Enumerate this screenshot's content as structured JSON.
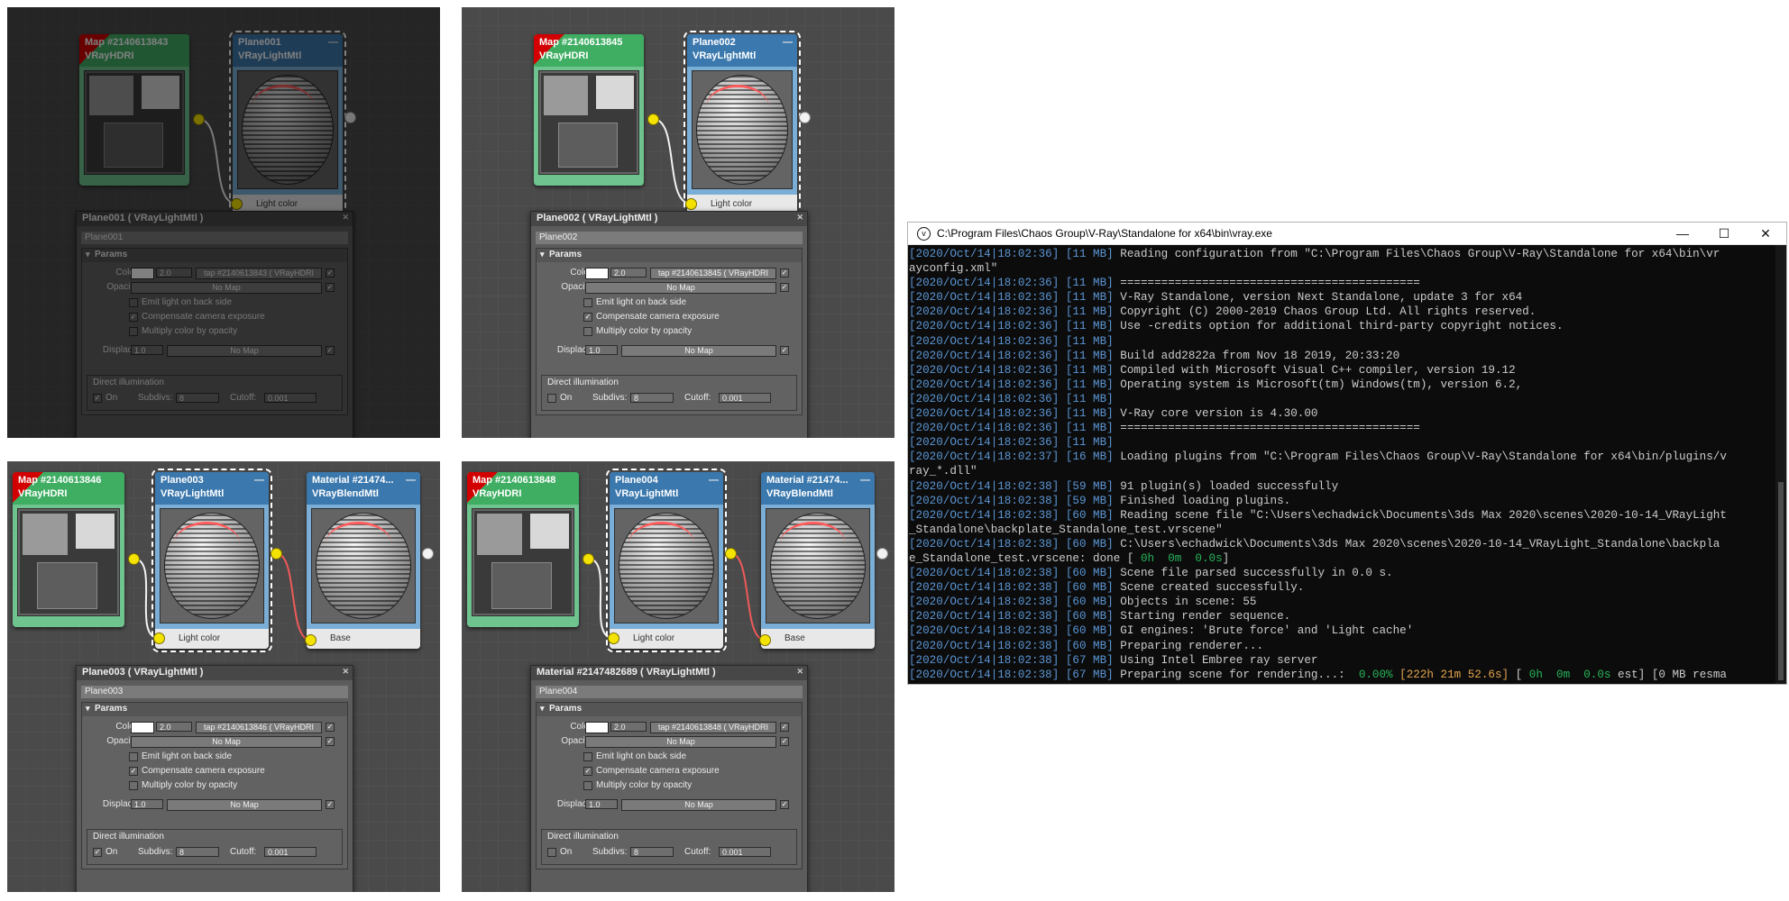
{
  "panels": [
    {
      "id": "p1",
      "dim": true,
      "hdri_node": {
        "title": "Map #2140613843",
        "type": "VRayHDRI"
      },
      "light_node": {
        "title": "Plane001",
        "type": "VRayLightMtl",
        "slot": "Light color"
      },
      "rollout": {
        "title": "Plane001  ( VRayLightMtl )",
        "name": "Plane001",
        "group": "Params",
        "color_label": "Color:",
        "color_mult": "2.0",
        "color_map": "tap #2140613843  ( VRayHDRI",
        "opacity_label": "Opacity:",
        "opacity_map": "No Map",
        "chk_back": "Emit light on back side",
        "chk_comp": "Compensate camera exposure",
        "chk_mult": "Multiply color by opacity",
        "displace_label": "Displace:",
        "displace_val": "1.0",
        "displace_map": "No Map",
        "di_title": "Direct illumination",
        "on_label": "On",
        "on_checked": true,
        "subdivs_label": "Subdivs:",
        "subdivs_val": "8",
        "cutoff_label": "Cutoff:",
        "cutoff_val": "0.001"
      }
    },
    {
      "id": "p2",
      "dim": false,
      "hdri_node": {
        "title": "Map #2140613845",
        "type": "VRayHDRI"
      },
      "light_node": {
        "title": "Plane002",
        "type": "VRayLightMtl",
        "slot": "Light color"
      },
      "rollout": {
        "title": "Plane002  ( VRayLightMtl )",
        "name": "Plane002",
        "group": "Params",
        "color_label": "Color:",
        "color_mult": "2.0",
        "color_map": "tap #2140613845  ( VRayHDRI",
        "opacity_label": "Opacity:",
        "opacity_map": "No Map",
        "chk_back": "Emit light on back side",
        "chk_comp": "Compensate camera exposure",
        "chk_mult": "Multiply color by opacity",
        "displace_label": "Displace:",
        "displace_val": "1.0",
        "displace_map": "No Map",
        "di_title": "Direct illumination",
        "on_label": "On",
        "on_checked": false,
        "subdivs_label": "Subdivs:",
        "subdivs_val": "8",
        "cutoff_label": "Cutoff:",
        "cutoff_val": "0.001"
      }
    },
    {
      "id": "p3",
      "dim": false,
      "hdri_node": {
        "title": "Map #2140613846",
        "type": "VRayHDRI"
      },
      "light_node": {
        "title": "Plane003",
        "type": "VRayLightMtl",
        "slot": "Light color"
      },
      "blend_node": {
        "title": "Material #21474...",
        "type": "VRayBlendMtl",
        "slot": "Base"
      },
      "rollout": {
        "title": "Plane003  ( VRayLightMtl )",
        "name": "Plane003",
        "group": "Params",
        "color_label": "Color:",
        "color_mult": "2.0",
        "color_map": "tap #2140613846  ( VRayHDRI",
        "opacity_label": "Opacity:",
        "opacity_map": "No Map",
        "chk_back": "Emit light on back side",
        "chk_comp": "Compensate camera exposure",
        "chk_mult": "Multiply color by opacity",
        "displace_label": "Displace:",
        "displace_val": "1.0",
        "displace_map": "No Map",
        "di_title": "Direct illumination",
        "on_label": "On",
        "on_checked": true,
        "subdivs_label": "Subdivs:",
        "subdivs_val": "8",
        "cutoff_label": "Cutoff:",
        "cutoff_val": "0.001"
      }
    },
    {
      "id": "p4",
      "dim": false,
      "hdri_node": {
        "title": "Map #2140613848",
        "type": "VRayHDRI"
      },
      "light_node": {
        "title": "Plane004",
        "type": "VRayLightMtl",
        "slot": "Light color"
      },
      "blend_node": {
        "title": "Material #21474...",
        "type": "VRayBlendMtl",
        "slot": "Base"
      },
      "rollout": {
        "title": "Material #2147482689  ( VRayLightMtl )",
        "name": "Plane004",
        "group": "Params",
        "color_label": "Color:",
        "color_mult": "2.0",
        "color_map": "tap #2140613848  ( VRayHDRI",
        "opacity_label": "Opacity:",
        "opacity_map": "No Map",
        "chk_back": "Emit light on back side",
        "chk_comp": "Compensate camera exposure",
        "chk_mult": "Multiply color by opacity",
        "displace_label": "Displace:",
        "displace_val": "1.0",
        "displace_map": "No Map",
        "di_title": "Direct illumination",
        "on_label": "On",
        "on_checked": false,
        "subdivs_label": "Subdivs:",
        "subdivs_val": "8",
        "cutoff_label": "Cutoff:",
        "cutoff_val": "0.001"
      }
    }
  ],
  "console": {
    "title": "C:\\Program Files\\Chaos Group\\V-Ray\\Standalone for x64\\bin\\vray.exe",
    "icons": {
      "app": "vray-icon",
      "minimize": "minimize-icon",
      "maximize": "maximize-icon",
      "close": "close-icon"
    },
    "lines": [
      [
        [
          "ts",
          "[2020/Oct/14|18:02:36]"
        ],
        [
          "t",
          " "
        ],
        [
          "mem",
          "[11 MB]"
        ],
        [
          "t",
          " Reading configuration from \"C:\\Program Files\\Chaos Group\\V-Ray\\Standalone for x64\\bin\\vr"
        ]
      ],
      [
        [
          "t",
          "ayconfig.xml\""
        ]
      ],
      [
        [
          "ts",
          "[2020/Oct/14|18:02:36]"
        ],
        [
          "t",
          " "
        ],
        [
          "mem",
          "[11 MB]"
        ],
        [
          "t",
          " ============================================"
        ]
      ],
      [
        [
          "ts",
          "[2020/Oct/14|18:02:36]"
        ],
        [
          "t",
          " "
        ],
        [
          "mem",
          "[11 MB]"
        ],
        [
          "t",
          " V-Ray Standalone, version Next Standalone, update 3 for x64"
        ]
      ],
      [
        [
          "ts",
          "[2020/Oct/14|18:02:36]"
        ],
        [
          "t",
          " "
        ],
        [
          "mem",
          "[11 MB]"
        ],
        [
          "t",
          " Copyright (C) 2000-2019 Chaos Group Ltd. All rights reserved."
        ]
      ],
      [
        [
          "ts",
          "[2020/Oct/14|18:02:36]"
        ],
        [
          "t",
          " "
        ],
        [
          "mem",
          "[11 MB]"
        ],
        [
          "t",
          " Use -credits option for additional third-party copyright notices."
        ]
      ],
      [
        [
          "ts",
          "[2020/Oct/14|18:02:36]"
        ],
        [
          "t",
          " "
        ],
        [
          "mem",
          "[11 MB]"
        ]
      ],
      [
        [
          "ts",
          "[2020/Oct/14|18:02:36]"
        ],
        [
          "t",
          " "
        ],
        [
          "mem",
          "[11 MB]"
        ],
        [
          "t",
          " Build add2822a from Nov 18 2019, 20:33:20"
        ]
      ],
      [
        [
          "ts",
          "[2020/Oct/14|18:02:36]"
        ],
        [
          "t",
          " "
        ],
        [
          "mem",
          "[11 MB]"
        ],
        [
          "t",
          " Compiled with Microsoft Visual C++ compiler, version 19.12"
        ]
      ],
      [
        [
          "ts",
          "[2020/Oct/14|18:02:36]"
        ],
        [
          "t",
          " "
        ],
        [
          "mem",
          "[11 MB]"
        ],
        [
          "t",
          " Operating system is Microsoft(tm) Windows(tm), version 6.2,"
        ]
      ],
      [
        [
          "ts",
          "[2020/Oct/14|18:02:36]"
        ],
        [
          "t",
          " "
        ],
        [
          "mem",
          "[11 MB]"
        ]
      ],
      [
        [
          "ts",
          "[2020/Oct/14|18:02:36]"
        ],
        [
          "t",
          " "
        ],
        [
          "mem",
          "[11 MB]"
        ],
        [
          "t",
          " V-Ray core version is 4.30.00"
        ]
      ],
      [
        [
          "ts",
          "[2020/Oct/14|18:02:36]"
        ],
        [
          "t",
          " "
        ],
        [
          "mem",
          "[11 MB]"
        ],
        [
          "t",
          " ============================================"
        ]
      ],
      [
        [
          "ts",
          "[2020/Oct/14|18:02:36]"
        ],
        [
          "t",
          " "
        ],
        [
          "mem",
          "[11 MB]"
        ]
      ],
      [
        [
          "ts",
          "[2020/Oct/14|18:02:37]"
        ],
        [
          "t",
          " "
        ],
        [
          "mem",
          "[16 MB]"
        ],
        [
          "t",
          " Loading plugins from \"C:\\Program Files\\Chaos Group\\V-Ray\\Standalone for x64\\bin/plugins/v"
        ]
      ],
      [
        [
          "t",
          "ray_*.dll\""
        ]
      ],
      [
        [
          "ts",
          "[2020/Oct/14|18:02:38]"
        ],
        [
          "t",
          " "
        ],
        [
          "mem",
          "[59 MB]"
        ],
        [
          "t",
          " 91 plugin(s) loaded successfully"
        ]
      ],
      [
        [
          "ts",
          "[2020/Oct/14|18:02:38]"
        ],
        [
          "t",
          " "
        ],
        [
          "mem",
          "[59 MB]"
        ],
        [
          "t",
          " Finished loading plugins."
        ]
      ],
      [
        [
          "ts",
          "[2020/Oct/14|18:02:38]"
        ],
        [
          "t",
          " "
        ],
        [
          "mem",
          "[60 MB]"
        ],
        [
          "t",
          " Reading scene file \"C:\\Users\\echadwick\\Documents\\3ds Max 2020\\scenes\\2020-10-14_VRayLight"
        ]
      ],
      [
        [
          "t",
          "_Standalone\\backplate_Standalone_test.vrscene\""
        ]
      ],
      [
        [
          "ts",
          "[2020/Oct/14|18:02:38]"
        ],
        [
          "t",
          " "
        ],
        [
          "mem",
          "[60 MB]"
        ],
        [
          "t",
          " C:\\Users\\echadwick\\Documents\\3ds Max 2020\\scenes\\2020-10-14_VRayLight_Standalone\\backpla"
        ]
      ],
      [
        [
          "t",
          "e_Standalone_test.vrscene: done [ "
        ],
        [
          "grn",
          "0h  0m  0.0s"
        ],
        [
          "t",
          "]"
        ]
      ],
      [
        [
          "ts",
          "[2020/Oct/14|18:02:38]"
        ],
        [
          "t",
          " "
        ],
        [
          "mem",
          "[60 MB]"
        ],
        [
          "t",
          " Scene file parsed successfully in 0.0 s."
        ]
      ],
      [
        [
          "ts",
          "[2020/Oct/14|18:02:38]"
        ],
        [
          "t",
          " "
        ],
        [
          "mem",
          "[60 MB]"
        ],
        [
          "t",
          " Scene created successfully."
        ]
      ],
      [
        [
          "ts",
          "[2020/Oct/14|18:02:38]"
        ],
        [
          "t",
          " "
        ],
        [
          "mem",
          "[60 MB]"
        ],
        [
          "t",
          " Objects in scene: 55"
        ]
      ],
      [
        [
          "ts",
          "[2020/Oct/14|18:02:38]"
        ],
        [
          "t",
          " "
        ],
        [
          "mem",
          "[60 MB]"
        ],
        [
          "t",
          " Starting render sequence."
        ]
      ],
      [
        [
          "ts",
          "[2020/Oct/14|18:02:38]"
        ],
        [
          "t",
          " "
        ],
        [
          "mem",
          "[60 MB]"
        ],
        [
          "t",
          " GI engines: 'Brute force' and 'Light cache'"
        ]
      ],
      [
        [
          "ts",
          "[2020/Oct/14|18:02:38]"
        ],
        [
          "t",
          " "
        ],
        [
          "mem",
          "[60 MB]"
        ],
        [
          "t",
          " Preparing renderer..."
        ]
      ],
      [
        [
          "ts",
          "[2020/Oct/14|18:02:38]"
        ],
        [
          "t",
          " "
        ],
        [
          "mem",
          "[67 MB]"
        ],
        [
          "t",
          " Using Intel Embree ray server"
        ]
      ],
      [
        [
          "ts",
          "[2020/Oct/14|18:02:38]"
        ],
        [
          "t",
          " "
        ],
        [
          "mem",
          "[67 MB]"
        ],
        [
          "t",
          " Preparing scene for rendering...:  "
        ],
        [
          "grn",
          "0.00%"
        ],
        [
          "t",
          " "
        ],
        [
          "org",
          "[222h 21m 52.6s]"
        ],
        [
          "t",
          " [ "
        ],
        [
          "grn",
          "0h  0m  0.0s"
        ],
        [
          "t",
          " est] [0 MB resma"
        ]
      ]
    ]
  }
}
